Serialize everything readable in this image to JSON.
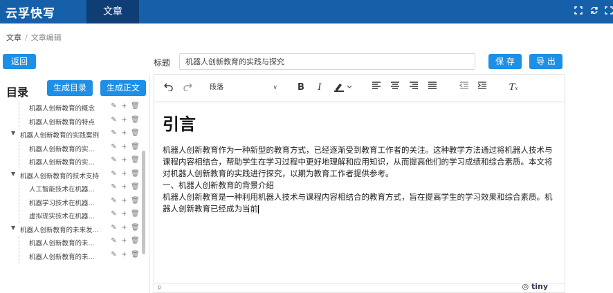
{
  "header": {
    "logo": "云孚快写",
    "active_tab": "文章"
  },
  "breadcrumb": {
    "root": "文章",
    "separator": "/",
    "current": "文章编辑"
  },
  "actions": {
    "back": "返回",
    "save": "保 存",
    "export": "导 出"
  },
  "title_field": {
    "label": "标题",
    "value": "机器人创新教育的实践与探究"
  },
  "toc": {
    "heading": "目录",
    "gen_toc": "生成目录",
    "gen_body": "生成正文",
    "items": [
      {
        "label": "机器人创新教育的概念",
        "level": 2
      },
      {
        "label": "机器人创新教育的特点",
        "level": 2
      },
      {
        "label": "机器人创新教育的实践案例",
        "level": 1
      },
      {
        "label": "机器人创新教育的实...",
        "level": 2
      },
      {
        "label": "机器人创新教育的实...",
        "level": 2
      },
      {
        "label": "机器人创新教育的技术支持",
        "level": 1
      },
      {
        "label": "人工智能技术在机器...",
        "level": 2
      },
      {
        "label": "机器学习技术在机器...",
        "level": 2
      },
      {
        "label": "虚拟现实技术在机器...",
        "level": 2
      },
      {
        "label": "机器人创新教育的未来发...",
        "level": 1
      },
      {
        "label": "机器人创新教育的未...",
        "level": 2
      },
      {
        "label": "机器人创新教育的未...",
        "level": 2
      }
    ]
  },
  "editor": {
    "format_select": "段落",
    "heading": "引言",
    "para1": "机器人创新教育作为一种新型的教育方式，已经逐渐受到教育工作者的关注。这种教学方法通过将机器人技术与课程内容相结合，帮助学生在学习过程中更好地理解和应用知识，从而提高他们的学习成绩和综合素质。本文将对机器人创新教育的实践进行探究，以期为教育工作者提供参考。",
    "para2": "一、机器人创新教育的背景介绍",
    "para3": "机器人创新教育是一种利用机器人技术与课程内容相结合的教育方式，旨在提高学生的学习效果和综合素质。机器人创新教育已经成为当前",
    "status_path": "p",
    "brand": "tiny"
  },
  "colors": {
    "topbar": "#1660aa",
    "active_tab": "#0f3e75",
    "button": "#1e8fe6"
  },
  "icons": [
    "fullscreen-icon",
    "refresh-icon",
    "expand-icon",
    "undo-icon",
    "redo-icon",
    "bold-icon",
    "italic-icon",
    "highlight-icon",
    "align-left-icon",
    "align-center-icon",
    "align-right-icon",
    "align-justify-icon",
    "outdent-icon",
    "indent-icon",
    "clear-format-icon",
    "edit-icon",
    "add-icon",
    "delete-icon"
  ]
}
